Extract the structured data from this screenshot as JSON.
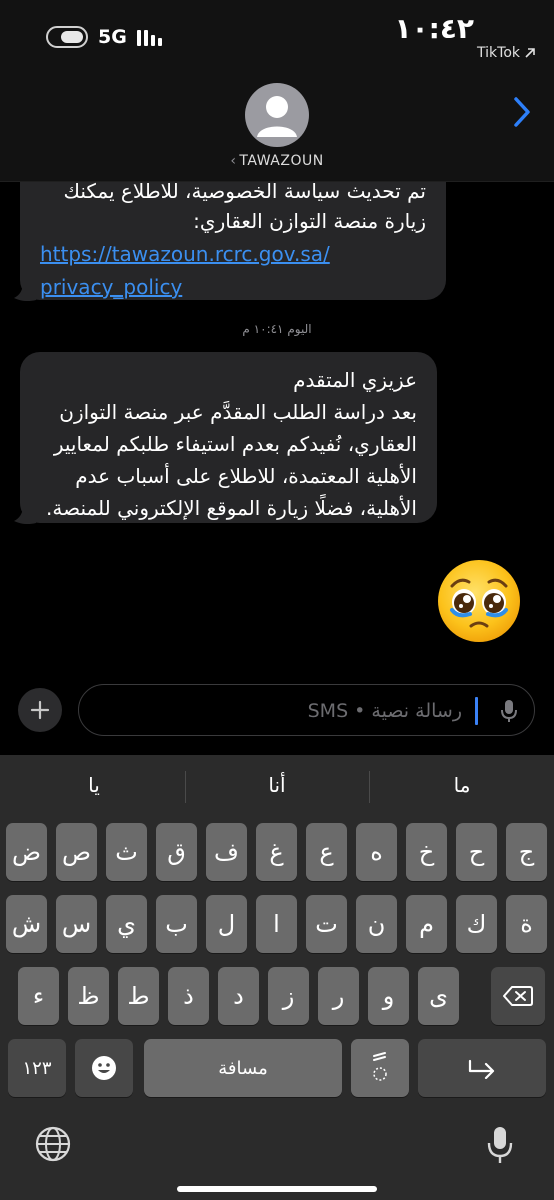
{
  "status_bar": {
    "network": "5G",
    "time": "١٠:٤٢",
    "back_app": "TikTok"
  },
  "header": {
    "contact_name": "TAWAZOUN"
  },
  "messages": {
    "first": {
      "partial_line": "تم تحديث سياسة الخصوصية، للاطلاع يمكنك",
      "line2": "زيارة منصة التوازن العقاري:",
      "link_line1": "https://tawazoun.rcrc.gov.sa/",
      "link_line2": "privacy_policy"
    },
    "timestamp": "اليوم ١٠:٤١ م",
    "second": {
      "line1": "عزيزي المتقدم",
      "line2": "بعد دراسة الطلب المقدَّم عبر منصة التوازن",
      "line3": "العقاري، نُفيدكم بعدم استيفاء طلبكم لمعايير",
      "line4": "الأهلية المعتمدة، للاطلاع على أسباب عدم",
      "line5": "الأهلية، فضلًا زيارة الموقع الإلكتروني للمنصة."
    },
    "emoji_icon": "pleading-face"
  },
  "composer": {
    "placeholder": "رسالة نصية • SMS"
  },
  "keyboard": {
    "suggestions": [
      "ما",
      "أنا",
      "يا"
    ],
    "row1": [
      "ج",
      "ح",
      "خ",
      "ه",
      "ع",
      "غ",
      "ف",
      "ق",
      "ث",
      "ص",
      "ض"
    ],
    "row2": [
      "ة",
      "ك",
      "م",
      "ن",
      "ت",
      "ا",
      "ل",
      "ب",
      "ي",
      "س",
      "ش"
    ],
    "row3": [
      "ى",
      "و",
      "ر",
      "ز",
      "د",
      "ذ",
      "ط",
      "ظ",
      "ء"
    ],
    "numbers_key": "١٢٣",
    "space_key": "مسافة",
    "diacritic_key": "ًً"
  }
}
